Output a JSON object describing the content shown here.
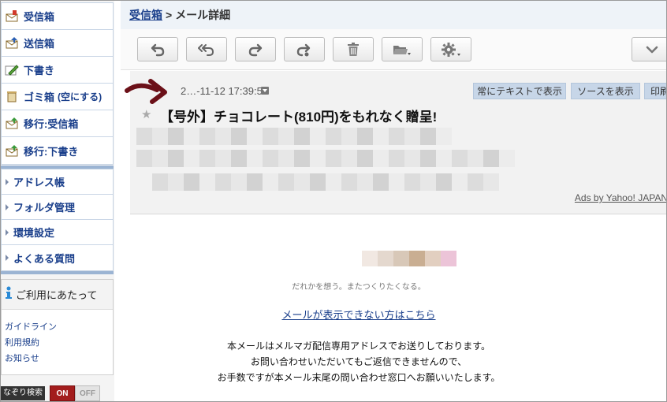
{
  "sidebar": {
    "folders": [
      {
        "label": "受信箱",
        "icon": "inbox-icon"
      },
      {
        "label": "送信箱",
        "icon": "outbox-icon"
      },
      {
        "label": "下書き",
        "icon": "draft-icon"
      },
      {
        "label": "ゴミ箱",
        "extra": "(空にする)",
        "icon": "trash-icon"
      },
      {
        "label": "移行:受信箱",
        "icon": "migrate-inbox-icon"
      },
      {
        "label": "移行:下書き",
        "icon": "migrate-draft-icon"
      }
    ],
    "menu": [
      {
        "label": "アドレス帳"
      },
      {
        "label": "フォルダ管理"
      },
      {
        "label": "環境設定"
      },
      {
        "label": "よくある質問"
      }
    ],
    "info": {
      "title": "ご利用にあたって",
      "links": [
        "ガイドライン",
        "利用規約",
        "お知らせ"
      ]
    },
    "search": {
      "label": "なぞり検索",
      "on": "ON",
      "off": "OFF"
    }
  },
  "breadcrumb": {
    "link": "受信箱",
    "separator": ">",
    "current": "メール詳細"
  },
  "toolbar": {
    "buttons": [
      "reply-icon",
      "reply-all-icon",
      "forward-icon",
      "forward-attach-icon",
      "delete-icon",
      "move-folder-icon",
      "settings-icon",
      "expand-icon"
    ]
  },
  "mail": {
    "date": "2…-11-12 17:39:51",
    "actions": [
      "常にテキストで表示",
      "ソースを表示",
      "印刷"
    ],
    "subject": "【号外】チョコレート(810円)をもれなく贈呈!",
    "ads": "Ads by Yahoo! JAPAN"
  },
  "body": {
    "faint_text": "だれかを想う。またつくりたくなる。",
    "view_link": "メールが表示できない方はこちら",
    "notice": [
      "本メールはメルマガ配信専用アドレスでお送りしております。",
      "お問い合わせいただいてもご返信できませんので、",
      "お手数ですが本メール末尾の問い合わせ窓口へお願いいたします。"
    ]
  },
  "colors": {
    "link": "#1a3f8b",
    "accent_bar": "#9bb4d3",
    "arrow": "#6b1018",
    "toggle_on": "#a31d1d"
  }
}
